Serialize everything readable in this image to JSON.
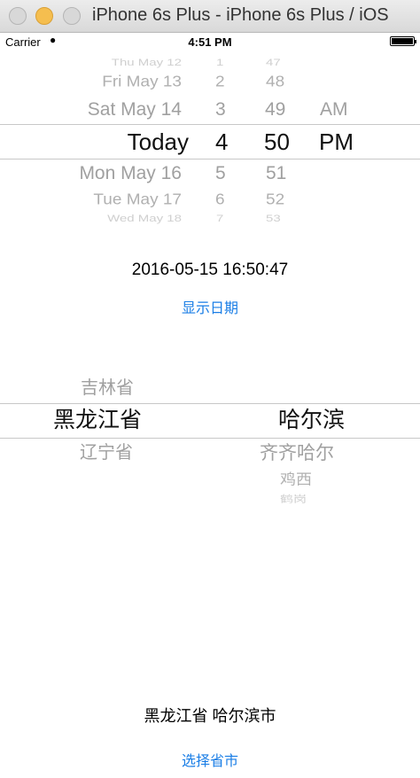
{
  "window": {
    "title": "iPhone 6s Plus - iPhone 6s Plus / iOS"
  },
  "status_bar": {
    "carrier": "Carrier",
    "time": "4:51 PM"
  },
  "date_picker": {
    "days": [
      "Thu May 12",
      "Fri May 13",
      "Sat May 14",
      "Today",
      "Mon May 16",
      "Tue May 17",
      "Wed May 18"
    ],
    "hours": [
      "1",
      "2",
      "3",
      "4",
      "5",
      "6",
      "7"
    ],
    "minutes": [
      "47",
      "48",
      "49",
      "50",
      "51",
      "52",
      "53"
    ],
    "ampm": [
      "AM",
      "PM"
    ]
  },
  "date_display": {
    "value": "2016-05-15 16:50:47"
  },
  "show_date_button": {
    "label": "显示日期"
  },
  "province_picker": {
    "provinces": [
      "吉林省",
      "黑龙江省",
      "辽宁省"
    ],
    "cities": [
      "哈尔滨",
      "齐齐哈尔",
      "鸡西",
      "鹤岗"
    ]
  },
  "selection_display": {
    "value": "黑龙江省 哈尔滨市"
  },
  "select_city_button": {
    "label": "选择省市"
  }
}
